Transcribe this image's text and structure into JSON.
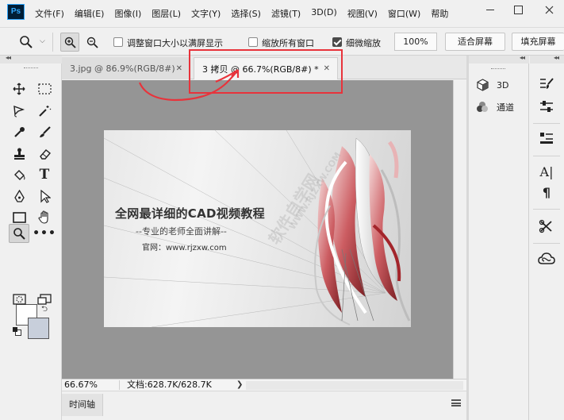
{
  "app": {
    "logo": "Ps",
    "menu": [
      "文件(F)",
      "编辑(E)",
      "图像(I)",
      "图层(L)",
      "文字(Y)",
      "选择(S)",
      "滤镜(T)",
      "3D(D)",
      "视图(V)",
      "窗口(W)",
      "帮助"
    ]
  },
  "options": {
    "resize_windows_label": "调整窗口大小以满屏显示",
    "resize_windows_checked": false,
    "zoom_all_label": "缩放所有窗口",
    "zoom_all_checked": false,
    "scrubby_label": "细微缩放",
    "scrubby_checked": true,
    "zoom_value": "100%",
    "fit_screen": "适合屏幕",
    "fill_screen": "填充屏幕"
  },
  "tabs": [
    {
      "label": "3.jpg @ 86.9%(RGB/8#)",
      "active": false
    },
    {
      "label": "3 拷贝 @ 66.7%(RGB/8#) *",
      "active": true
    }
  ],
  "document": {
    "title": "全网最详细的CAD视频教程",
    "subtitle": "--专业的老师全面讲解--",
    "website": "官网：www.rjzxw.com",
    "watermark_cn": "软件自学网",
    "watermark_url": "WWW.RJZXW.COM"
  },
  "status": {
    "zoom": "66.67%",
    "doc_size": "文档:628.7K/628.7K"
  },
  "timeline": {
    "label": "时间轴"
  },
  "panels": [
    {
      "icon": "cube-icon",
      "label": "3D"
    },
    {
      "icon": "channels-icon",
      "label": "通道"
    }
  ],
  "colors": {
    "annotation": "#e8333b",
    "foreground": "#ffffff",
    "background": "#c8cfdb",
    "canvas_bg": "#959595"
  }
}
